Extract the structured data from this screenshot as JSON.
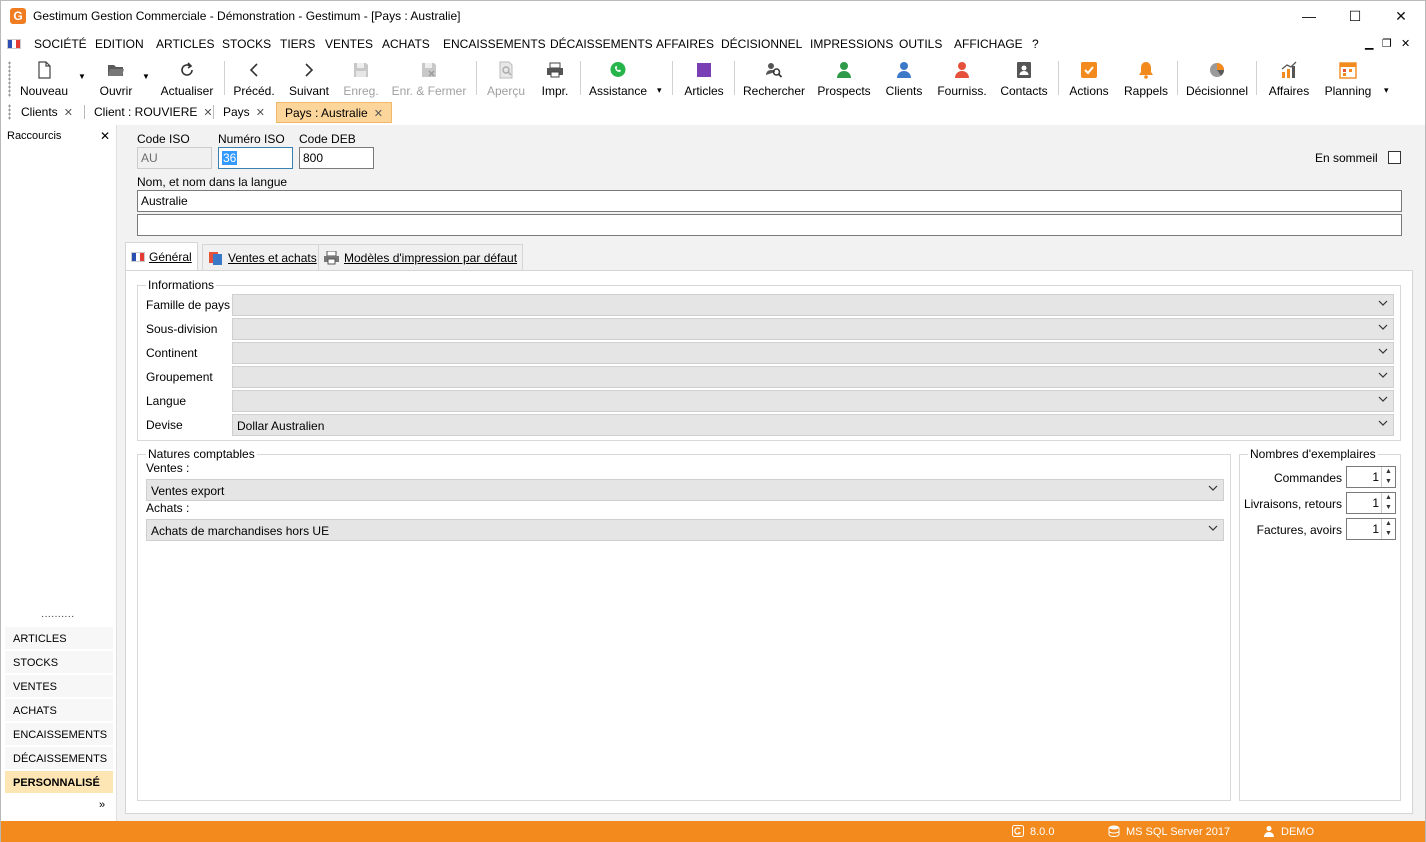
{
  "window": {
    "title": "Gestimum Gestion Commerciale - Démonstration - Gestimum - [Pays : Australie]",
    "logo_letter": "G",
    "minimize": "—",
    "maximize": "☐",
    "close": "✕"
  },
  "menu": {
    "items": [
      "SOCIÉTÉ",
      "EDITION",
      "ARTICLES",
      "STOCKS",
      "TIERS",
      "VENTES",
      "ACHATS",
      "ENCAISSEMENTS",
      "DÉCAISSEMENTS",
      "AFFAIRES",
      "DÉCISIONNEL",
      "IMPRESSIONS",
      "OUTILS",
      "AFFICHAGE",
      "?"
    ],
    "mdi_minimize": "▁",
    "mdi_restore": "❐",
    "mdi_close": "✕"
  },
  "toolbar": {
    "nouveau": "Nouveau",
    "ouvrir": "Ouvrir",
    "actualiser": "Actualiser",
    "preced": "Précéd.",
    "suivant": "Suivant",
    "enreg": "Enreg.",
    "enr_fermer": "Enr. & Fermer",
    "apercu": "Aperçu",
    "impr": "Impr.",
    "assistance": "Assistance",
    "articles": "Articles",
    "rechercher": "Rechercher",
    "prospects": "Prospects",
    "clients": "Clients",
    "fourniss": "Fourniss.",
    "contacts": "Contacts",
    "actions": "Actions",
    "rappels": "Rappels",
    "decisionnel": "Décisionnel",
    "affaires": "Affaires",
    "planning": "Planning",
    "icons": {
      "nouveau": "new-document-icon",
      "ouvrir": "open-folder-icon",
      "actualiser": "refresh-icon",
      "preced": "chevron-left-icon",
      "suivant": "chevron-right-icon",
      "enreg": "save-icon",
      "enr_fermer": "save-close-icon",
      "apercu": "preview-icon",
      "impr": "print-icon",
      "assistance": "whatsapp-icon",
      "articles": "cube-icon",
      "rechercher": "search-people-icon",
      "prospects": "person-green-icon",
      "clients": "person-blue-icon",
      "fourniss": "person-red-icon",
      "contacts": "contact-card-icon",
      "actions": "checkbox-icon",
      "rappels": "bell-icon",
      "decisionnel": "pie-chart-icon",
      "affaires": "growth-chart-icon",
      "planning": "calendar-icon"
    },
    "accent_colors": {
      "whatsapp": "#25b54a",
      "articles": "#7b3fb5",
      "prospects": "#2e9a4a",
      "clients": "#3c78c8",
      "fourniss": "#e5513b",
      "actions": "#f28a1e",
      "rappels": "#f28a1e"
    }
  },
  "doc_tabs": [
    {
      "label": "Clients",
      "close": "✕"
    },
    {
      "label": "Client : ROUVIERE",
      "close": "✕"
    },
    {
      "label": "Pays",
      "close": "✕"
    },
    {
      "label": "Pays : Australie",
      "close": "✕",
      "active": true
    }
  ],
  "left_panel": {
    "title": "Raccourcis",
    "close": "✕",
    "dots": "··········",
    "items": [
      "ARTICLES",
      "STOCKS",
      "VENTES",
      "ACHATS",
      "ENCAISSEMENTS",
      "DÉCAISSEMENTS",
      "PERSONNALISÉ"
    ],
    "active_item": "PERSONNALISÉ",
    "more": "»"
  },
  "form": {
    "code_iso_label": "Code ISO",
    "code_iso_value": "AU",
    "numero_iso_label": "Numéro ISO",
    "numero_iso_value": "36",
    "code_deb_label": "Code DEB",
    "code_deb_value": "800",
    "en_sommeil_label": "En sommeil",
    "en_sommeil_checked": false,
    "nom_label": "Nom, et nom dans la langue",
    "nom_value": "Australie",
    "nom_langue_value": ""
  },
  "inner_tabs": [
    "Général",
    "Ventes et achats",
    "Modèles d'impression par défaut"
  ],
  "informations": {
    "title": "Informations",
    "fields": [
      {
        "label": "Famille de pays",
        "value": ""
      },
      {
        "label": "Sous-division",
        "value": ""
      },
      {
        "label": "Continent",
        "value": ""
      },
      {
        "label": "Groupement",
        "value": ""
      },
      {
        "label": "Langue",
        "value": ""
      },
      {
        "label": "Devise",
        "value": "Dollar Australien"
      }
    ]
  },
  "natures": {
    "title": "Natures comptables",
    "ventes_label": "Ventes :",
    "ventes_value": "Ventes export",
    "achats_label": "Achats :",
    "achats_value": "Achats de marchandises hors UE"
  },
  "exemplaires": {
    "title": "Nombres d'exemplaires",
    "fields": [
      {
        "label": "Commandes",
        "value": "1"
      },
      {
        "label": "Livraisons, retours",
        "value": "1"
      },
      {
        "label": "Factures, avoirs",
        "value": "1"
      }
    ]
  },
  "status": {
    "version": "8.0.0",
    "server": "MS SQL Server 2017",
    "user": "DEMO",
    "bar_color": "#f28a1e"
  }
}
